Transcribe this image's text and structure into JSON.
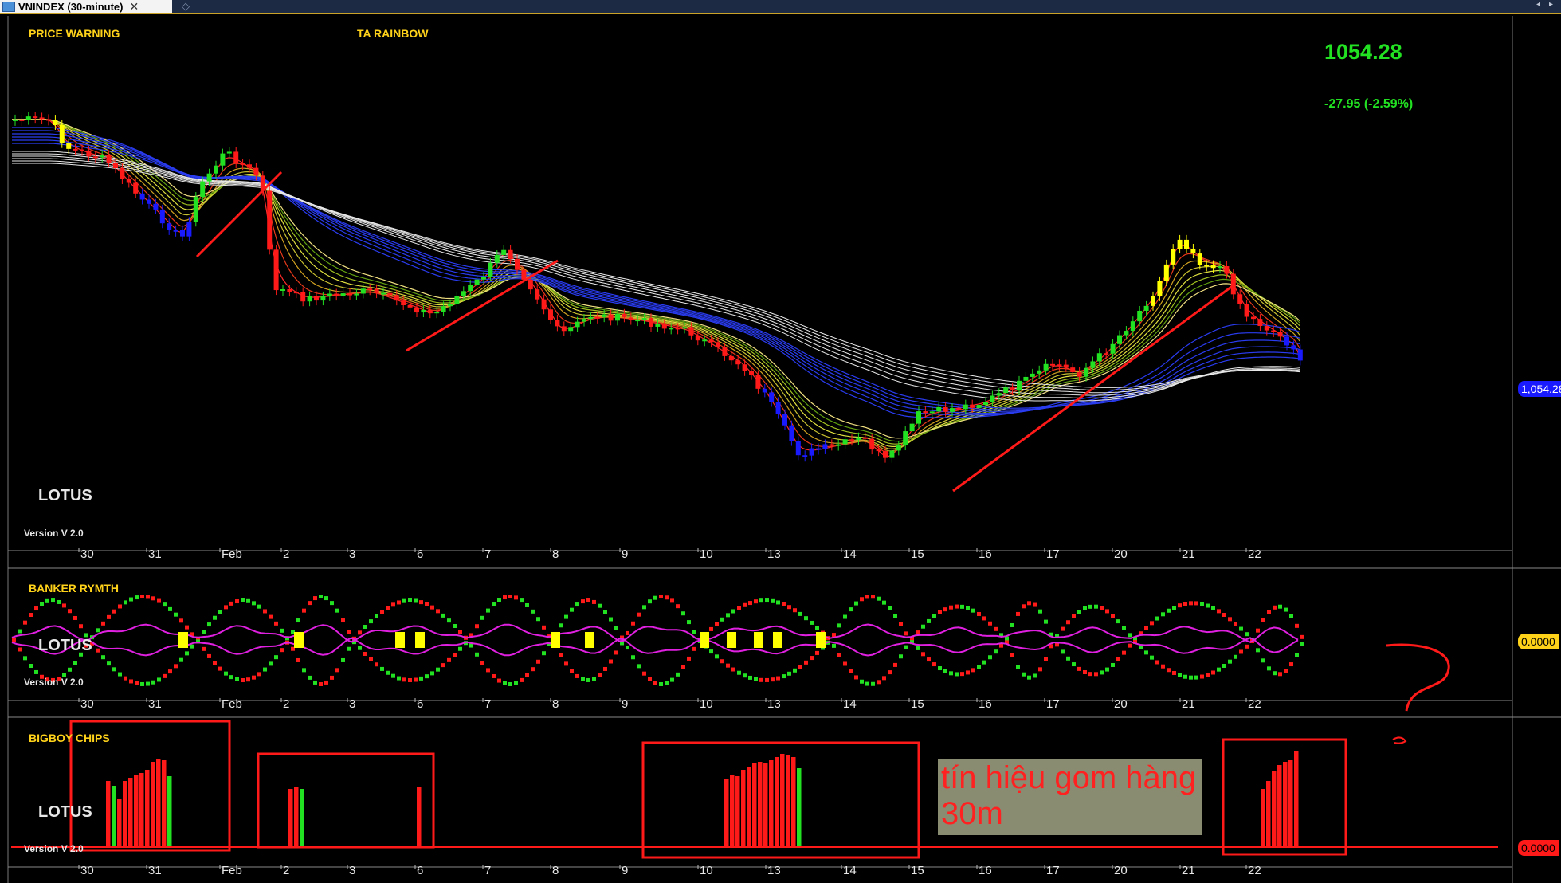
{
  "window": {
    "tab_title": "VNINDEX (30-minute)",
    "tab_close": "✕",
    "tab_pin": "◇",
    "nav_left": "◂",
    "nav_right": "▸"
  },
  "price_panel": {
    "label_warning": "PRICE WARNING",
    "label_rainbow": "TA RAINBOW",
    "last_price": "1054.28",
    "change": "-27.95 (-2.59%)",
    "price_tag": "1,054.28",
    "watermark": "LOTUS",
    "version": "Version V 2.0"
  },
  "banker_panel": {
    "label": "BANKER RYMTH",
    "watermark": "LOTUS",
    "version": "Version V 2.0",
    "value_tag": "0.0000"
  },
  "bigboy_panel": {
    "label": "BIGBOY CHIPS",
    "watermark": "LOTUS",
    "version": "Version V 2.0",
    "value_tag": "0.0000",
    "annotation": "tín hiệu gom hàng 30m"
  },
  "x_axis": [
    "30",
    "31",
    "Feb",
    "2",
    "3",
    "6",
    "7",
    "8",
    "9",
    "10",
    "13",
    "14",
    "15",
    "16",
    "17",
    "20",
    "21",
    "22"
  ],
  "colors": {
    "up": "#22e022",
    "down": "#ff1a1a",
    "strong_up": "#ffff00",
    "strong_down": "#1a1aff",
    "label": "#ffd21a",
    "annotation": "#ff1a1a"
  }
}
